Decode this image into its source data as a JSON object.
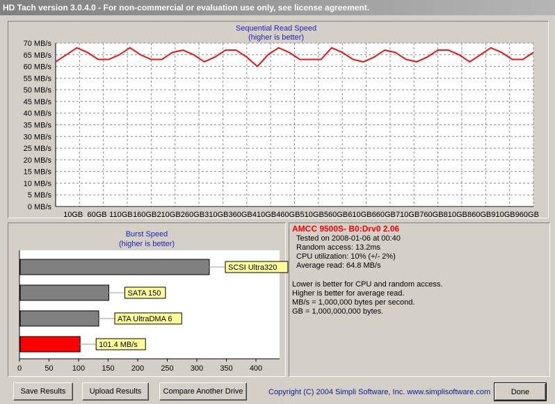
{
  "window": {
    "title": "HD Tach version 3.0.4.0  - For non-commercial or evaluation use only, see license agreement."
  },
  "seq_chart": {
    "title_line1": "Sequential Read Speed",
    "title_line2": "(higher is better)"
  },
  "burst_chart": {
    "title_line1": "Burst Speed",
    "title_line2": "(higher is better)"
  },
  "chart_data": [
    {
      "type": "line",
      "title": "Sequential Read Speed",
      "subtitle": "(higher is better)",
      "y_tick_labels": [
        "0 MB/s",
        "5 MB/s",
        "10 MB/s",
        "15 MB/s",
        "20 MB/s",
        "25 MB/s",
        "30 MB/s",
        "35 MB/s",
        "40 MB/s",
        "45 MB/s",
        "50 MB/s",
        "55 MB/s",
        "60 MB/s",
        "65 MB/s",
        "70 MB/s"
      ],
      "x_tick_labels": [
        "10GB",
        "60GB",
        "110GB",
        "160GB",
        "210GB",
        "260GB",
        "310GB",
        "360GB",
        "410GB",
        "460GB",
        "510GB",
        "560GB",
        "610GB",
        "660GB",
        "710GB",
        "760GB",
        "810GB",
        "860GB",
        "910GB",
        "960GB"
      ],
      "ylim": [
        0,
        70
      ],
      "grid": true,
      "color": "#ee1111",
      "series": [
        {
          "x": [
            0,
            22,
            44,
            66,
            88,
            110,
            132,
            154,
            176,
            198,
            220,
            242,
            264,
            286,
            308,
            330,
            352,
            374,
            396,
            418,
            440,
            462,
            484,
            506,
            528,
            550,
            572,
            594,
            616,
            638,
            660,
            682,
            704,
            726,
            748,
            770,
            792,
            814,
            836,
            858,
            880,
            902,
            924,
            946,
            968,
            990
          ],
          "y": [
            62,
            65,
            68,
            66,
            63,
            63,
            65,
            68,
            65,
            63,
            63,
            66,
            67,
            65,
            62,
            64,
            67,
            67,
            64,
            60,
            65,
            68,
            66,
            63,
            63,
            63,
            68,
            66,
            63,
            62,
            64,
            67,
            66,
            63,
            62,
            64,
            67,
            67,
            65,
            62,
            65,
            68,
            66,
            63,
            63,
            66
          ]
        }
      ]
    },
    {
      "type": "bar",
      "orientation": "horizontal",
      "title": "Burst Speed",
      "subtitle": "(higher is better)",
      "categories": [
        "SCSI Ultra320",
        "SATA 150",
        "ATA UltraDMA 6",
        "101.4 MB/s"
      ],
      "values": [
        320,
        150,
        133,
        101.4
      ],
      "colors": [
        "#808080",
        "#808080",
        "#808080",
        "#ff0000"
      ],
      "x_tick_labels": [
        "0",
        "50",
        "100",
        "150",
        "200",
        "250",
        "300",
        "350",
        "400"
      ],
      "xlim": [
        0,
        440
      ],
      "label_bg": "#ffff99"
    }
  ],
  "results": {
    "drive_name": "AMCC 9500S- B0:Drv0 2.06",
    "tested": "Tested on 2008-01-06 at 00:40",
    "random_access": "Random access: 13.2ms",
    "cpu": "CPU utilization: 10% (+/- 2%)",
    "average_read": "Average read: 64.8 MB/s",
    "note1": "Lower is better for CPU and random access.",
    "note2": "Higher is better for average read.",
    "note3": "MB/s = 1,000,000 bytes per second.",
    "note4": "GB = 1,000,000,000 bytes."
  },
  "buttons": {
    "save": "Save Results",
    "upload": "Upload Results",
    "compare": "Compare Another Drive",
    "done": "Done"
  },
  "copyright": "Copyright (C) 2004 Simpli Software, Inc. www.simplisoftware.com"
}
